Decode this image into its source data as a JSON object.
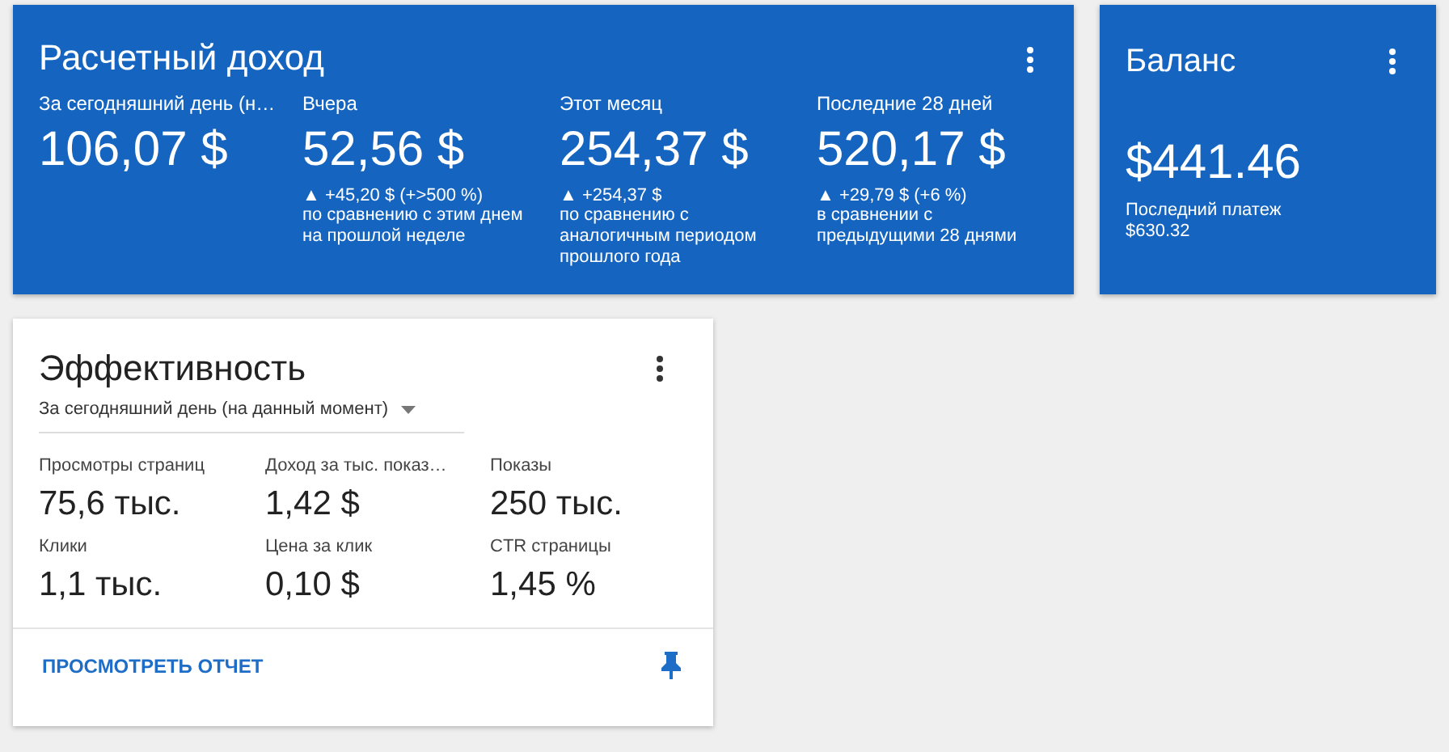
{
  "earnings": {
    "title": "Расчетный доход",
    "stats": [
      {
        "label": "За сегодняшний день (н…",
        "value": "106,07 $"
      },
      {
        "label": "Вчера",
        "value": "52,56 $",
        "delta": "▲ +45,20 $ (+>500 %)",
        "comparison": "по сравнению с этим днем на прошлой неделе"
      },
      {
        "label": "Этот месяц",
        "value": "254,37 $",
        "delta": "▲ +254,37 $",
        "comparison": "по сравнению с аналогичным периодом прошлого года"
      },
      {
        "label": "Последние 28 дней",
        "value": "520,17 $",
        "delta": "▲ +29,79 $ (+6 %)",
        "comparison": "в сравнении с предыдущими 28 днями"
      }
    ]
  },
  "balance": {
    "title": "Баланс",
    "value": "$441.46",
    "last_payment_label": "Последний платеж",
    "last_payment": "$630.32"
  },
  "performance": {
    "title": "Эффективность",
    "period": "За сегодняшний день (на данный момент)",
    "metrics": [
      {
        "label": "Просмотры страниц",
        "value": "75,6 тыс."
      },
      {
        "label": "Доход за тыс. показ…",
        "value": "1,42 $"
      },
      {
        "label": "Показы",
        "value": "250 тыс."
      },
      {
        "label": "Клики",
        "value": "1,1 тыс."
      },
      {
        "label": "Цена за клик",
        "value": "0,10 $"
      },
      {
        "label": "CTR страницы",
        "value": "1,45 %"
      }
    ],
    "report_link": "ПРОСМОТРЕТЬ ОТЧЕТ"
  }
}
